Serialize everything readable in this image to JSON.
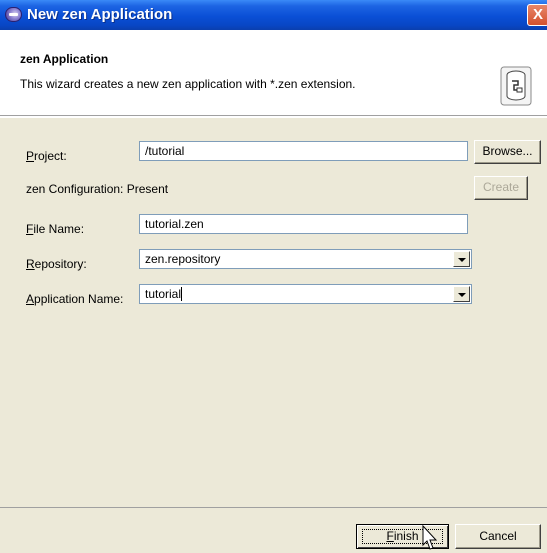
{
  "window": {
    "title": "New zen Application",
    "close_glyph": "X"
  },
  "banner": {
    "title": "zen Application",
    "description": "This wizard creates a new zen application with *.zen extension.",
    "icon": "database-wizard-icon"
  },
  "form": {
    "project": {
      "label_mnemonic": "P",
      "label_rest": "roject:",
      "value": "/tutorial",
      "browse_label": "Browse..."
    },
    "configuration": {
      "label": "zen Configuration:",
      "status": "Present",
      "create_label": "Create"
    },
    "file_name": {
      "label_mnemonic": "F",
      "label_rest": "ile Name:",
      "value": "tutorial.zen"
    },
    "repository": {
      "label_mnemonic": "R",
      "label_rest": "epository:",
      "value": "zen.repository"
    },
    "application_name": {
      "label_mnemonic": "A",
      "label_rest": "pplication Name:",
      "value": "tutorial"
    }
  },
  "footer": {
    "finish_mnemonic": "F",
    "finish_rest": "inish",
    "cancel_label": "Cancel"
  },
  "colors": {
    "titlebar": "#0a4fd6",
    "dialog_bg": "#ece9d8",
    "field_border": "#7f9db9",
    "close": "#d4512d"
  }
}
